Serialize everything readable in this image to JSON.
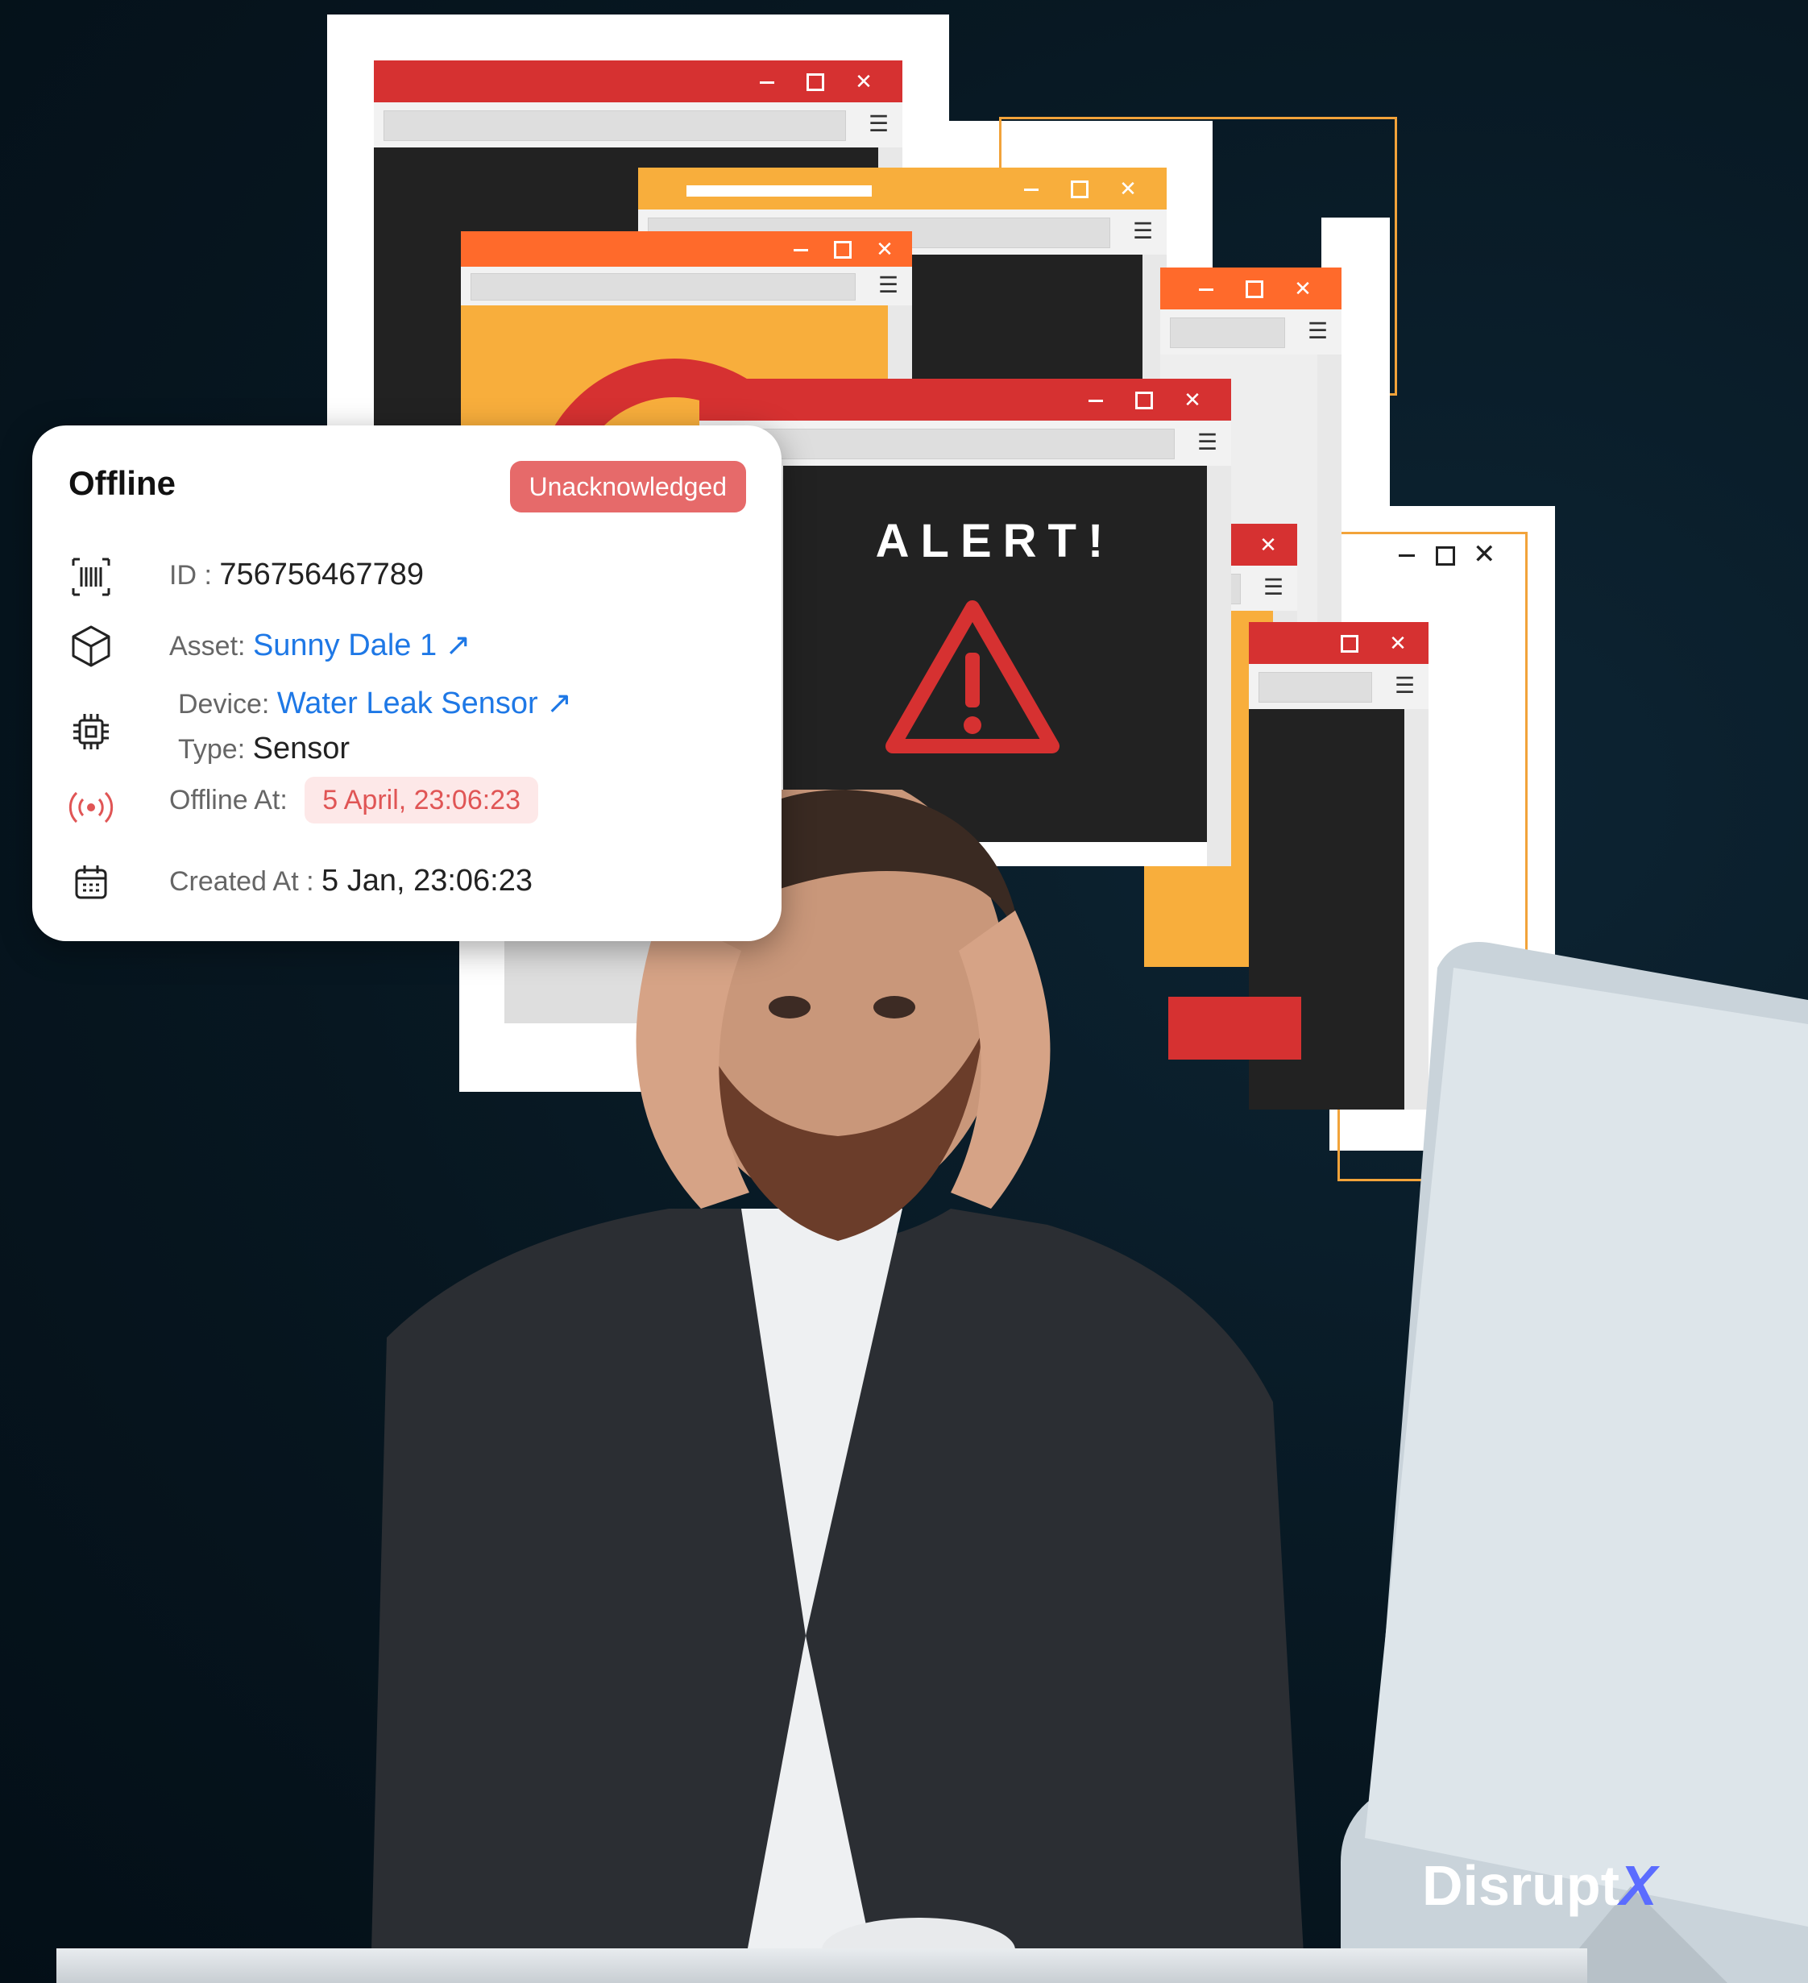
{
  "card": {
    "status": "Offline",
    "badge": "Unacknowledged",
    "id_label": "ID :",
    "id_value": "756756467789",
    "asset_label": "Asset:",
    "asset_value": "Sunny Dale 1 ↗",
    "device_label": "Device:",
    "device_value": "Water Leak Sensor ↗",
    "type_label": "Type:",
    "type_value": "Sensor",
    "offline_at_label": "Offline At:",
    "offline_at_value": "5 April, 23:06:23",
    "created_at_label": "Created At :",
    "created_at_value": "5 Jan, 23:06:23",
    "icons": [
      "barcode-icon",
      "cube-icon",
      "chip-icon",
      "broadcast-icon",
      "calendar-icon"
    ]
  },
  "alert": {
    "text": "ALERT!"
  },
  "logo": {
    "text": "Disrupt",
    "mark": "X"
  },
  "colors": {
    "red": "#d63131",
    "orange": "#ff6a2b",
    "amber": "#f8ae3c",
    "link": "#1e78e6",
    "badge": "#e66a6a",
    "background": "#071721"
  }
}
